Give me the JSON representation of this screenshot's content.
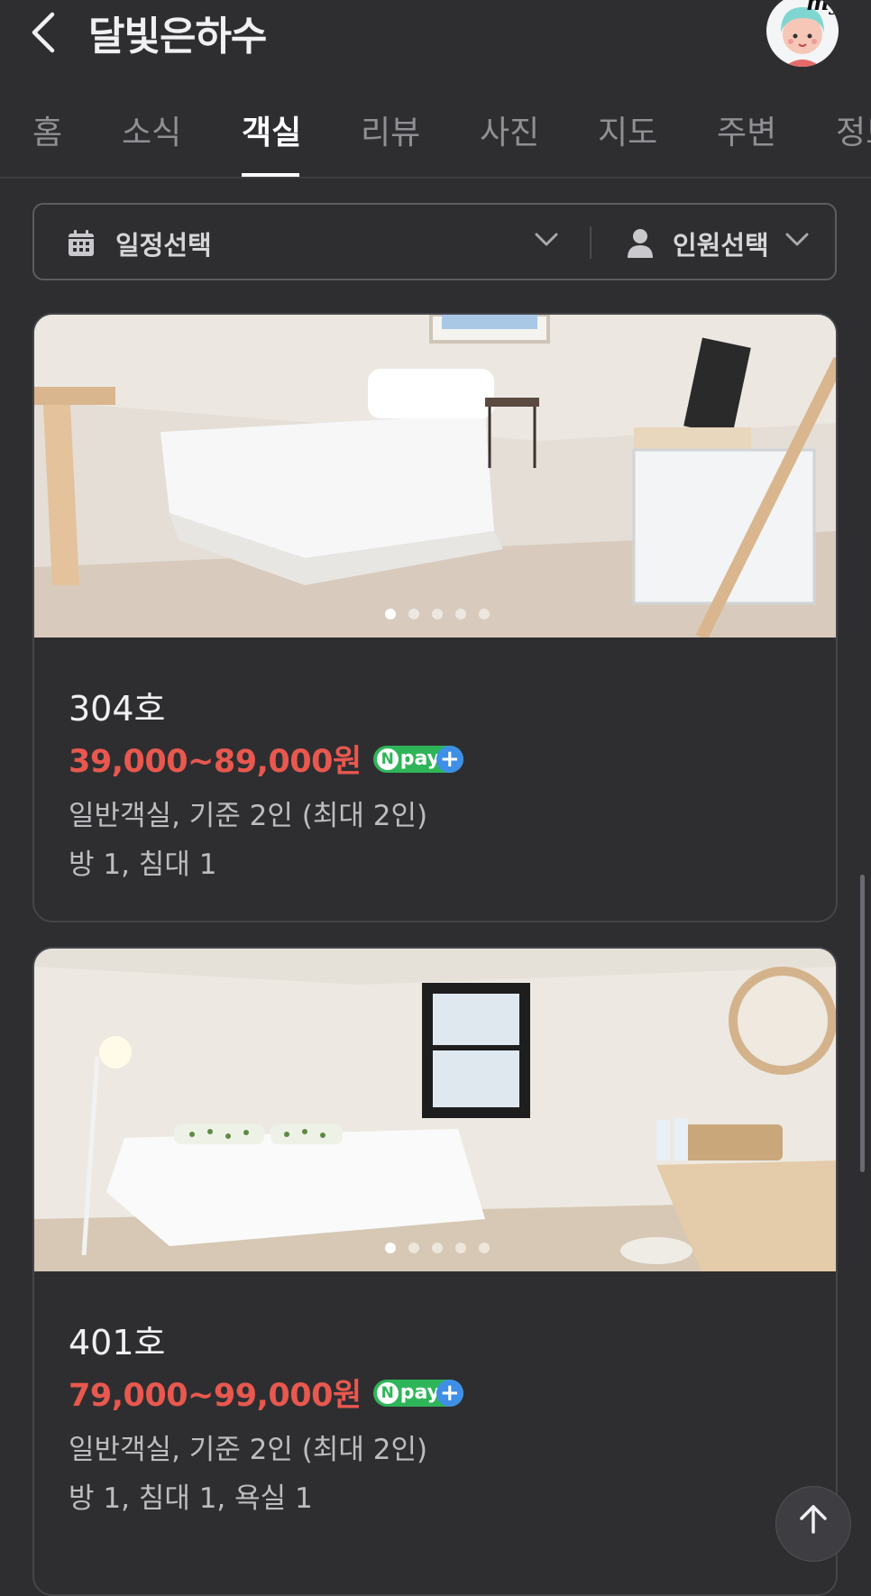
{
  "header": {
    "title": "달빛은하수",
    "avatar_text": "my"
  },
  "tabs": [
    {
      "label": "홈"
    },
    {
      "label": "소식"
    },
    {
      "label": "객실"
    },
    {
      "label": "리뷰"
    },
    {
      "label": "사진"
    },
    {
      "label": "지도"
    },
    {
      "label": "주변"
    },
    {
      "label": "정보"
    }
  ],
  "active_tab": "객실",
  "filter": {
    "date_label": "일정선택",
    "people_label": "인원선택"
  },
  "rooms": [
    {
      "name": "304호",
      "price": "39,000~89,000원",
      "badge": "pay",
      "desc1": "일반객실, 기준 2인 (최대 2인)",
      "desc2": "방 1, 침대 1",
      "photo_count": 5,
      "photo_index": 1
    },
    {
      "name": "401호",
      "price": "79,000~99,000원",
      "badge": "pay",
      "desc1": "일반객실, 기준 2인 (최대 2인)",
      "desc2": "방 1, 침대 1, 욕실 1",
      "photo_count": 5,
      "photo_index": 1
    }
  ],
  "colors": {
    "background": "#2e2e31",
    "price": "#e8584e",
    "npay_green": "#2fb559",
    "npay_blue": "#3f8fe6"
  },
  "icons": [
    "back-arrow-icon",
    "calendar-icon",
    "chevron-down-icon",
    "person-icon",
    "arrow-up-icon"
  ]
}
